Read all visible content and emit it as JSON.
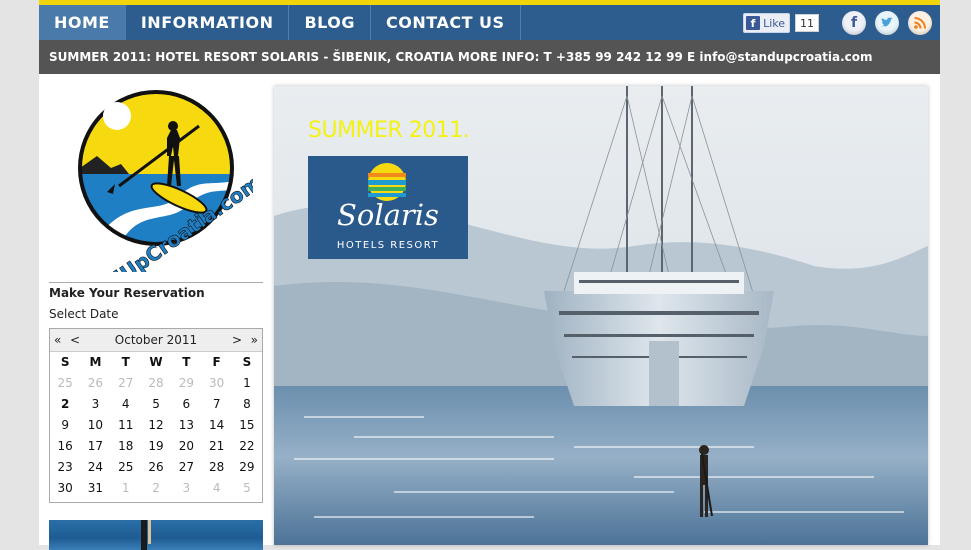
{
  "nav": {
    "items": [
      {
        "label": "HOME",
        "active": true
      },
      {
        "label": "INFORMATION",
        "active": false
      },
      {
        "label": "BLOG",
        "active": false
      },
      {
        "label": "CONTACT US",
        "active": false
      }
    ]
  },
  "social": {
    "fb_like_label": "Like",
    "fb_like_count": "11",
    "icons": [
      "facebook-icon",
      "twitter-icon",
      "rss-icon"
    ]
  },
  "infobar": {
    "text": "SUMMER 2011: HOTEL RESORT SOLARIS - ŠIBENIK, CROATIA   MORE INFO:  T +385 99 242 12 99  E info@standupcroatia.com"
  },
  "logo": {
    "text": "StandUpCroatia.com"
  },
  "reservation": {
    "title": "Make Your Reservation",
    "select_date": "Select Date"
  },
  "calendar": {
    "prev_year": "«",
    "prev_month": "<",
    "month_label": "October 2011",
    "next_month": ">",
    "next_year": "»",
    "weekdays": [
      "S",
      "M",
      "T",
      "W",
      "T",
      "F",
      "S"
    ],
    "weeks": [
      [
        "25",
        "26",
        "27",
        "28",
        "29",
        "30",
        "1"
      ],
      [
        "2",
        "3",
        "4",
        "5",
        "6",
        "7",
        "8"
      ],
      [
        "9",
        "10",
        "11",
        "12",
        "13",
        "14",
        "15"
      ],
      [
        "16",
        "17",
        "18",
        "19",
        "20",
        "21",
        "22"
      ],
      [
        "23",
        "24",
        "25",
        "26",
        "27",
        "28",
        "29"
      ],
      [
        "30",
        "31",
        "1",
        "2",
        "3",
        "4",
        "5"
      ]
    ],
    "today": "2"
  },
  "hero": {
    "title": "SUMMER 2011.",
    "brand_name": "Solaris",
    "brand_sub": "HOTELS RESORT"
  },
  "colors": {
    "nav_bg": "#2c5d8e",
    "accent_yellow": "#f2d40a",
    "info_bg": "#545454",
    "solaris_bg": "#2a598c"
  }
}
